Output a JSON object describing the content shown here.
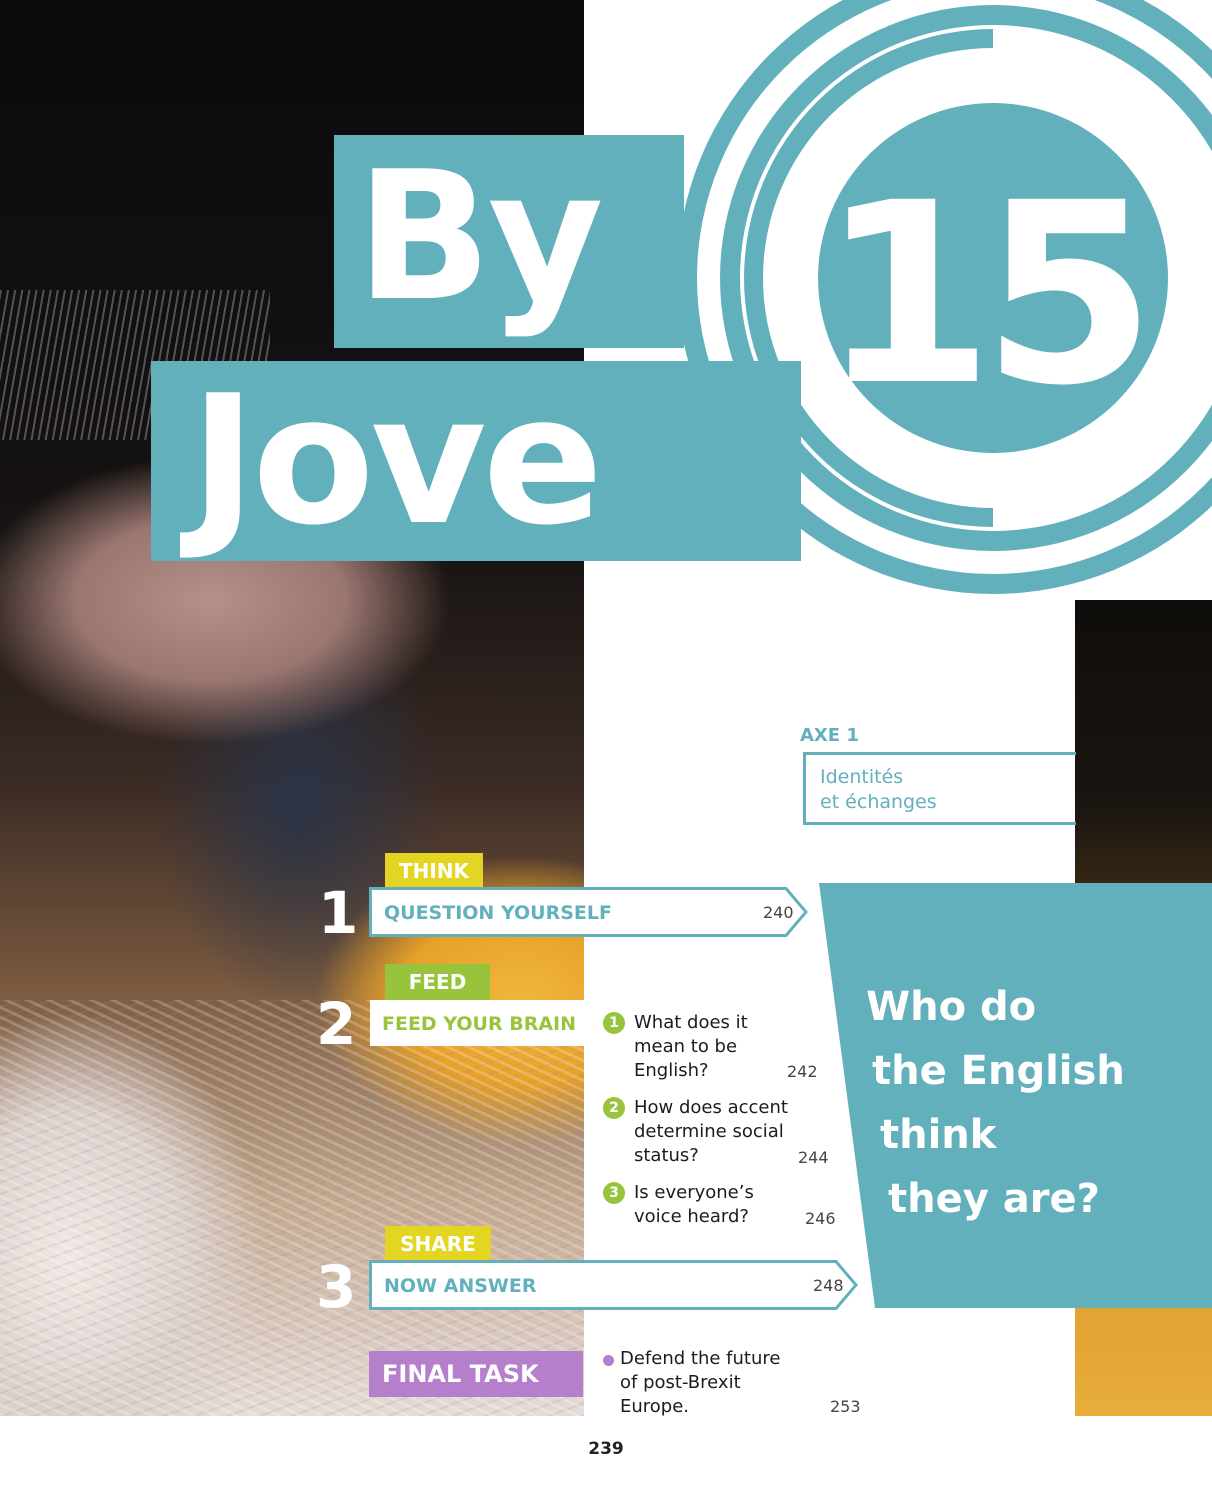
{
  "title": {
    "line1": "By",
    "line2": "Jove",
    "unit_number": "15"
  },
  "axe": {
    "label": "AXE 1",
    "theme_line1": "Identités",
    "theme_line2": "et échanges"
  },
  "question": {
    "line1": "Who do",
    "line2": "the English",
    "line3": "think",
    "line4": "they are?"
  },
  "steps": [
    {
      "number": "1",
      "tag": "THINK",
      "label": "QUESTION YOURSELF",
      "page": "240"
    },
    {
      "number": "2",
      "tag": "FEED",
      "label": "FEED YOUR BRAIN"
    },
    {
      "number": "3",
      "tag": "SHARE",
      "label": "NOW ANSWER",
      "page": "248"
    }
  ],
  "sub_questions": [
    {
      "num": "1",
      "line1": "What does it",
      "line2": "mean to be",
      "line3": "English?",
      "page": "242"
    },
    {
      "num": "2",
      "line1": "How does accent",
      "line2": "determine social",
      "line3": "status?",
      "page": "244"
    },
    {
      "num": "3",
      "line1": "Is everyone’s",
      "line2": "voice heard?",
      "page": "246"
    }
  ],
  "final_task": {
    "label": "FINAL TASK",
    "line1": "Defend the future",
    "line2": "of post-Brexit",
    "line3": "Europe.",
    "page": "253"
  },
  "page_number": "239",
  "colors": {
    "teal": "#63b0bd",
    "yellow": "#e3d521",
    "green": "#97c43c",
    "purple": "#b57fcb"
  }
}
